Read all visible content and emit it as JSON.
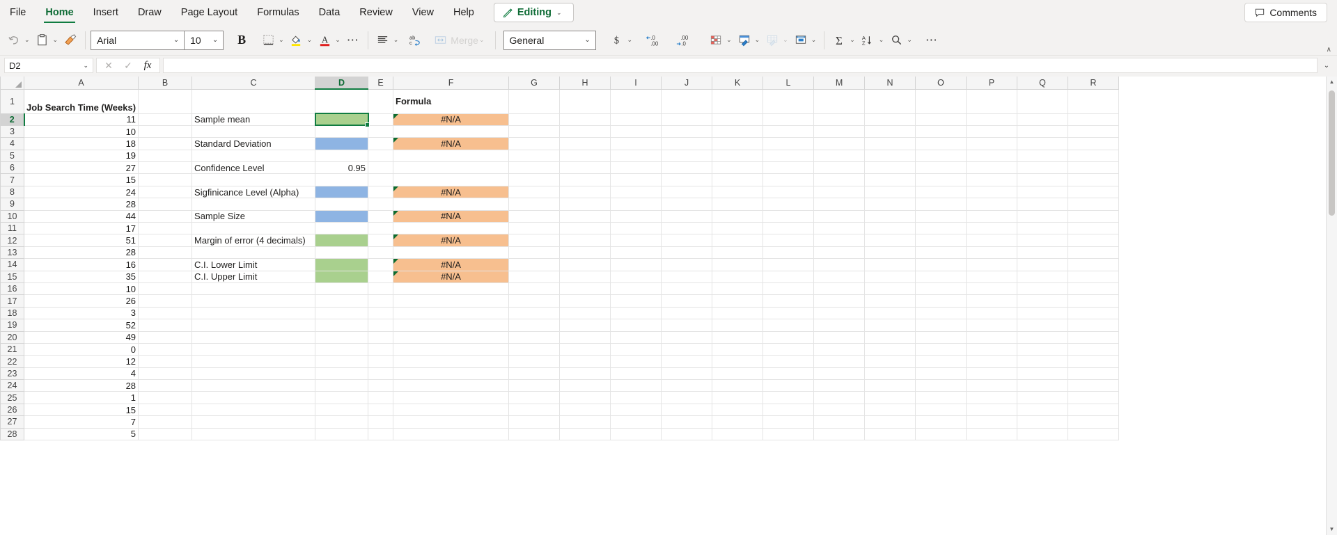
{
  "tabs": [
    {
      "label": "File",
      "active": false
    },
    {
      "label": "Home",
      "active": true
    },
    {
      "label": "Insert",
      "active": false
    },
    {
      "label": "Draw",
      "active": false
    },
    {
      "label": "Page Layout",
      "active": false
    },
    {
      "label": "Formulas",
      "active": false
    },
    {
      "label": "Data",
      "active": false
    },
    {
      "label": "Review",
      "active": false
    },
    {
      "label": "View",
      "active": false
    },
    {
      "label": "Help",
      "active": false
    }
  ],
  "editing_mode": {
    "label": "Editing",
    "icon": "pencil-icon",
    "chevron": "⌄"
  },
  "comments": {
    "label": "Comments",
    "icon": "comment-icon"
  },
  "ribbon": {
    "undo": {
      "icon": "undo-icon"
    },
    "paste": {
      "icon": "clipboard-icon"
    },
    "format_painter": {
      "icon": "format-painter-icon"
    },
    "font_name": "Arial",
    "font_size": "10",
    "bold": "B",
    "borders": {
      "icon": "borders-icon"
    },
    "fill_color": {
      "icon": "fill-color-icon"
    },
    "font_color": {
      "icon": "font-color-icon"
    },
    "more_font": "⋯",
    "align": {
      "icon": "align-icon"
    },
    "wrap_text": {
      "icon": "wrap-text-icon"
    },
    "merge_label": "Merge",
    "number_format": "General",
    "currency": {
      "icon": "currency-icon"
    },
    "decrease_decimal": {
      "icon": "decrease-decimal-icon"
    },
    "increase_decimal": {
      "icon": "increase-decimal-icon"
    },
    "conditional_formatting": {
      "icon": "conditional-formatting-icon"
    },
    "format_as_table": {
      "icon": "format-as-table-icon"
    },
    "cell_styles": {
      "icon": "cell-styles-icon"
    },
    "insert_cells": {
      "icon": "insert-cells-icon"
    },
    "autosum": {
      "icon": "autosum-icon"
    },
    "sort_filter": {
      "icon": "sort-filter-icon"
    },
    "find": {
      "icon": "search-icon"
    },
    "more_commands": "⋯",
    "collapse": "∧"
  },
  "formula_bar": {
    "name_box": "D2",
    "cancel": "✕",
    "enter": "✓",
    "fx": "fx",
    "value": "",
    "placeholder": ""
  },
  "grid": {
    "columns": [
      "A",
      "B",
      "C",
      "D",
      "E",
      "F",
      "G",
      "H",
      "I",
      "J",
      "K",
      "L",
      "M",
      "N",
      "O",
      "P",
      "Q",
      "R"
    ],
    "selected_column": "D",
    "selected_row": 2,
    "selected_cell": "D2",
    "header_a": "Job Search Time (Weeks)",
    "header_f": "Formula",
    "error_value": "#N/A",
    "confidence_level_value": "0.95",
    "labels": {
      "sample_mean": "Sample mean",
      "standard_deviation": "Standard Deviation",
      "confidence_level": "Confidence Level",
      "significance_level": "Sigfinicance Level (Alpha)",
      "sample_size": "Sample Size",
      "margin_of_error": "Margin of error (4 decimals)",
      "ci_lower": "C.I. Lower Limit",
      "ci_upper": "C.I. Upper Limit"
    },
    "column_a_values": [
      11,
      10,
      18,
      19,
      27,
      15,
      24,
      28,
      44,
      17,
      51,
      28,
      16,
      35,
      10,
      26,
      3,
      52,
      49,
      0,
      12,
      4,
      28,
      1,
      15,
      7,
      5
    ],
    "rows": [
      {
        "n": 1,
        "a": "",
        "c": "",
        "d": "",
        "dfill": "",
        "f": "",
        "ffill": ""
      },
      {
        "n": 2,
        "a": "11",
        "c": "Sample mean",
        "d": "",
        "dfill": "green",
        "f": "#N/A",
        "ffill": "orange"
      },
      {
        "n": 3,
        "a": "10",
        "c": "",
        "d": "",
        "dfill": "",
        "f": "",
        "ffill": ""
      },
      {
        "n": 4,
        "a": "18",
        "c": "Standard Deviation",
        "d": "",
        "dfill": "blue",
        "f": "#N/A",
        "ffill": "orange"
      },
      {
        "n": 5,
        "a": "19",
        "c": "",
        "d": "",
        "dfill": "",
        "f": "",
        "ffill": ""
      },
      {
        "n": 6,
        "a": "27",
        "c": "Confidence Level",
        "d": "0.95",
        "dfill": "",
        "f": "",
        "ffill": ""
      },
      {
        "n": 7,
        "a": "15",
        "c": "",
        "d": "",
        "dfill": "",
        "f": "",
        "ffill": ""
      },
      {
        "n": 8,
        "a": "24",
        "c": "Sigfinicance Level (Alpha)",
        "d": "",
        "dfill": "blue",
        "f": "#N/A",
        "ffill": "orange"
      },
      {
        "n": 9,
        "a": "28",
        "c": "",
        "d": "",
        "dfill": "",
        "f": "",
        "ffill": ""
      },
      {
        "n": 10,
        "a": "44",
        "c": "Sample Size",
        "d": "",
        "dfill": "blue",
        "f": "#N/A",
        "ffill": "orange"
      },
      {
        "n": 11,
        "a": "17",
        "c": "",
        "d": "",
        "dfill": "",
        "f": "",
        "ffill": ""
      },
      {
        "n": 12,
        "a": "51",
        "c": "Margin of error (4 decimals)",
        "d": "",
        "dfill": "green",
        "f": "#N/A",
        "ffill": "orange"
      },
      {
        "n": 13,
        "a": "28",
        "c": "",
        "d": "",
        "dfill": "",
        "f": "",
        "ffill": ""
      },
      {
        "n": 14,
        "a": "16",
        "c": "C.I. Lower Limit",
        "d": "",
        "dfill": "green",
        "f": "#N/A",
        "ffill": "orange"
      },
      {
        "n": 15,
        "a": "35",
        "c": "C.I. Upper Limit",
        "d": "",
        "dfill": "green",
        "f": "#N/A",
        "ffill": "orange"
      },
      {
        "n": 16,
        "a": "10",
        "c": "",
        "d": "",
        "dfill": "",
        "f": "",
        "ffill": ""
      },
      {
        "n": 17,
        "a": "26",
        "c": "",
        "d": "",
        "dfill": "",
        "f": "",
        "ffill": ""
      },
      {
        "n": 18,
        "a": "3",
        "c": "",
        "d": "",
        "dfill": "",
        "f": "",
        "ffill": ""
      },
      {
        "n": 19,
        "a": "52",
        "c": "",
        "d": "",
        "dfill": "",
        "f": "",
        "ffill": ""
      },
      {
        "n": 20,
        "a": "49",
        "c": "",
        "d": "",
        "dfill": "",
        "f": "",
        "ffill": ""
      },
      {
        "n": 21,
        "a": "0",
        "c": "",
        "d": "",
        "dfill": "",
        "f": "",
        "ffill": ""
      },
      {
        "n": 22,
        "a": "12",
        "c": "",
        "d": "",
        "dfill": "",
        "f": "",
        "ffill": ""
      },
      {
        "n": 23,
        "a": "4",
        "c": "",
        "d": "",
        "dfill": "",
        "f": "",
        "ffill": ""
      },
      {
        "n": 24,
        "a": "28",
        "c": "",
        "d": "",
        "dfill": "",
        "f": "",
        "ffill": ""
      },
      {
        "n": 25,
        "a": "1",
        "c": "",
        "d": "",
        "dfill": "",
        "f": "",
        "ffill": ""
      },
      {
        "n": 26,
        "a": "15",
        "c": "",
        "d": "",
        "dfill": "",
        "f": "",
        "ffill": ""
      },
      {
        "n": 27,
        "a": "7",
        "c": "",
        "d": "",
        "dfill": "",
        "f": "",
        "ffill": ""
      },
      {
        "n": 28,
        "a": "5",
        "c": "",
        "d": "",
        "dfill": "",
        "f": "",
        "ffill": ""
      }
    ]
  },
  "colors": {
    "accent_green": "#107c41",
    "fill_blue": "#8eb4e3",
    "fill_green": "#a9d08e",
    "fill_orange": "#f7bf8f",
    "ribbon_bg": "#f3f2f1"
  },
  "scrollbar": {
    "up": "▲",
    "down": "▼"
  }
}
